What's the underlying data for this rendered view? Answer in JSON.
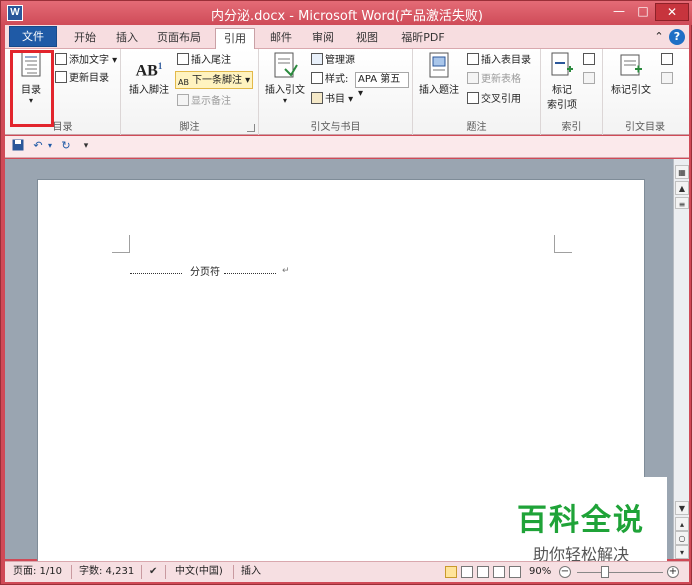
{
  "window": {
    "title": "内分泌.docx - Microsoft Word(产品激活失败)",
    "app_icon": "W"
  },
  "tabs": {
    "file": "文件",
    "items": [
      "开始",
      "插入",
      "页面布局",
      "引用",
      "邮件",
      "审阅",
      "视图",
      "福昕PDF"
    ],
    "active": "引用"
  },
  "ribbon": {
    "toc": {
      "label": "目录",
      "add_text": "添加文字",
      "update_toc": "更新目录",
      "group": "目录"
    },
    "footnotes": {
      "insert_footnote": "插入脚注",
      "insert_endnote": "插入尾注",
      "next_footnote": "下一条脚注",
      "show_notes": "显示备注",
      "group": "脚注",
      "ab_glyph": "AB",
      "sup": "1"
    },
    "citations": {
      "insert_citation": "插入引文",
      "manage_sources": "管理源",
      "style_label": "样式:",
      "style_value": "APA 第五",
      "bibliography": "书目",
      "group": "引文与书目"
    },
    "captions": {
      "insert_caption": "插入题注",
      "insert_table_of_figures": "插入表目录",
      "update_table": "更新表格",
      "cross_reference": "交叉引用",
      "group": "题注"
    },
    "index": {
      "mark_entry_line1": "标记",
      "mark_entry_line2": "索引项",
      "group": "索引"
    },
    "toa": {
      "mark_citation": "标记引文",
      "group": "引文目录"
    }
  },
  "document": {
    "page_break_text": "分页符",
    "para_mark": "↵"
  },
  "watermark": {
    "title": "百科全说",
    "subtitle": "助你轻松解决"
  },
  "statusbar": {
    "page": "页面: 1/10",
    "words": "字数: 4,231",
    "language": "中文(中国)",
    "mode": "插入",
    "zoom": "90%"
  }
}
